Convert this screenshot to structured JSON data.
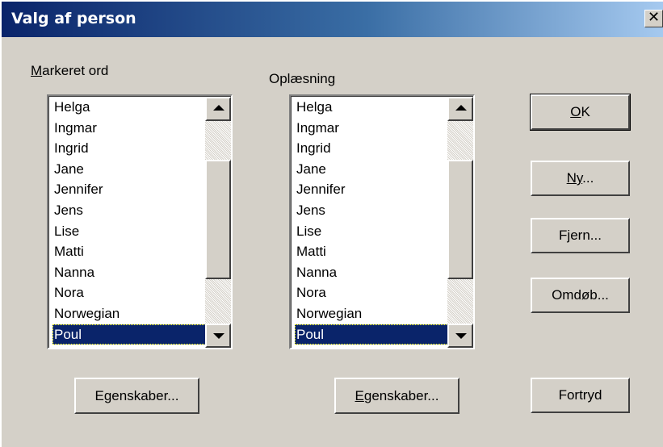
{
  "window": {
    "title": "Valg af person",
    "close_glyph": "✕"
  },
  "left_list": {
    "label_access": "M",
    "label_rest": "arkeret ord",
    "items": [
      "Helga",
      "Ingmar",
      "Ingrid",
      "Jane",
      "Jennifer",
      "Jens",
      "Lise",
      "Matti",
      "Nanna",
      "Nora",
      "Norwegian",
      "Poul"
    ],
    "selected": "Poul",
    "button_label": "Egenskaber..."
  },
  "right_list": {
    "label": "Oplæsning",
    "items": [
      "Helga",
      "Ingmar",
      "Ingrid",
      "Jane",
      "Jennifer",
      "Jens",
      "Lise",
      "Matti",
      "Nanna",
      "Nora",
      "Norwegian",
      "Poul"
    ],
    "selected": "Poul",
    "button_access": "E",
    "button_rest": "genskaber..."
  },
  "buttons": {
    "ok_access": "O",
    "ok_rest": "K",
    "ny_access": "N",
    "ny_mid": "y",
    "ny_rest": "...",
    "fjern": "Fjern...",
    "omdob": "Omdøb...",
    "fortryd": "Fortryd"
  },
  "icons": {
    "close": "close-icon",
    "scroll_up": "arrow-up-icon",
    "scroll_down": "arrow-down-icon"
  },
  "colors": {
    "title_start": "#0a246a",
    "title_end": "#a6caf0",
    "selection": "#0a246a",
    "face": "#d4d0c8"
  }
}
